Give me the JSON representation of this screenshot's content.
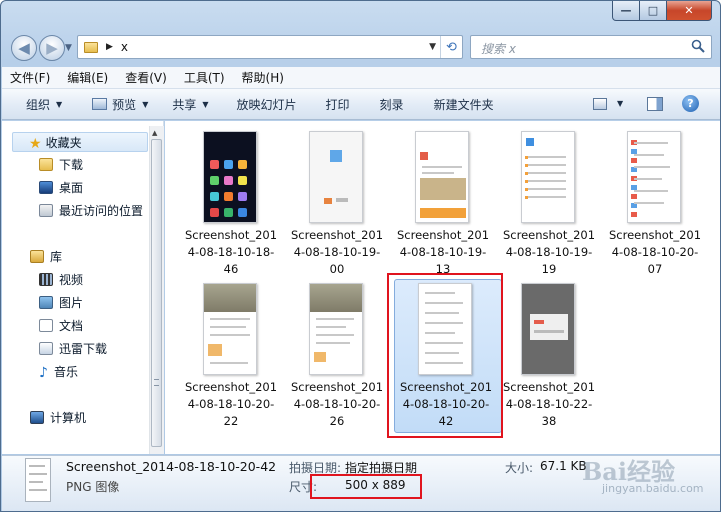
{
  "window": {
    "minimize": "—",
    "maximize": "□",
    "close": "✕"
  },
  "address": {
    "path_segment": "x",
    "search_placeholder": "搜索 x"
  },
  "menu": [
    "文件(F)",
    "编辑(E)",
    "查看(V)",
    "工具(T)",
    "帮助(H)"
  ],
  "toolbar": {
    "organize": "组织",
    "preview": "预览",
    "share": "共享",
    "slideshow": "放映幻灯片",
    "print": "打印",
    "burn": "刻录",
    "new_folder": "新建文件夹"
  },
  "sidebar": {
    "favorites": "收藏夹",
    "downloads": "下载",
    "desktop": "桌面",
    "recent": "最近访问的位置",
    "libraries": "库",
    "videos": "视频",
    "pictures": "图片",
    "documents": "文档",
    "thunder": "迅雷下载",
    "music": "音乐",
    "computer": "计算机"
  },
  "files": [
    {
      "name": "Screenshot_2014-08-18-10-18-46"
    },
    {
      "name": "Screenshot_2014-08-18-10-19-00"
    },
    {
      "name": "Screenshot_2014-08-18-10-19-13"
    },
    {
      "name": "Screenshot_2014-08-18-10-19-19"
    },
    {
      "name": "Screenshot_2014-08-18-10-20-07"
    },
    {
      "name": "Screenshot_2014-08-18-10-20-22"
    },
    {
      "name": "Screenshot_2014-08-18-10-20-26"
    },
    {
      "name": "Screenshot_2014-08-18-10-20-42",
      "selected": true
    },
    {
      "name": "Screenshot_2014-08-18-10-22-38"
    }
  ],
  "details": {
    "name": "Screenshot_2014-08-18-10-20-42",
    "type": "PNG 图像",
    "date_label": "拍摄日期:",
    "date_value": "指定拍摄日期",
    "dims_label": "尺寸:",
    "dims_value": "500 x 889",
    "size_label": "大小:",
    "size_value": "67.1 KB"
  },
  "watermark": {
    "brand": "Bai经验",
    "url": "jingyan.baidu.com"
  },
  "colors": {
    "highlight_box": "#e0141e",
    "selection": "#c2dcf7"
  }
}
